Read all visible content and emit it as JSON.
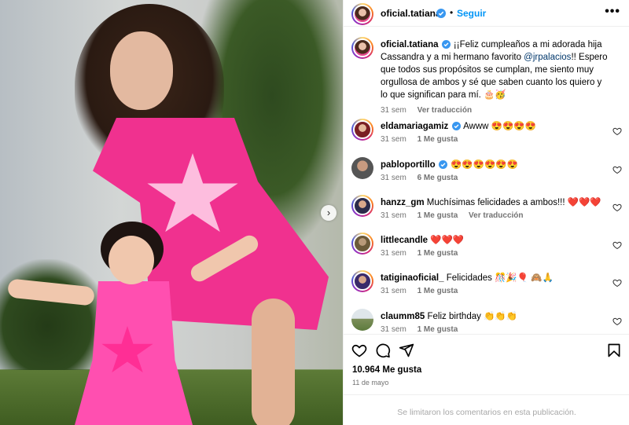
{
  "post": {
    "author": "oficial.tatiana",
    "follow_label": "Seguir",
    "more_label": "•••",
    "caption": "¡¡Feliz cumpleaños a mi adorada hija Cassandra y a mi hermano favorito ",
    "mention": "@jrpalacios",
    "caption_end": "!! Espero que todos sus propósitos se cumplan, me siento muy orgullosa de ambos y sé que saben cuanto los quiero y lo que significan para mí. 🎂🥳",
    "caption_time": "31 sem",
    "translate_label": "Ver traducción",
    "likes": "10.964 Me gusta",
    "date": "11 de mayo",
    "comments_limited": "Se limitaron los comentarios en esta publicación."
  },
  "carousel": {
    "next_icon": "›"
  },
  "comments": [
    {
      "user": "eldamariagamiz",
      "verified": true,
      "text": "Awww 😍😍😍😍",
      "time": "31 sem",
      "likes": "1 Me gusta",
      "translate": ""
    },
    {
      "user": "pabloportillo",
      "verified": true,
      "text": "😍😍😍😍😍😍",
      "time": "31 sem",
      "likes": "6 Me gusta",
      "translate": ""
    },
    {
      "user": "hanzz_gm",
      "verified": false,
      "text": "Muchísimas felicidades a ambos!!! ❤️❤️❤️",
      "time": "31 sem",
      "likes": "1 Me gusta",
      "translate": "Ver traducción"
    },
    {
      "user": "littlecandle",
      "verified": false,
      "text": "❤️❤️❤️",
      "time": "31 sem",
      "likes": "1 Me gusta",
      "translate": ""
    },
    {
      "user": "tatiginaoficial_",
      "verified": false,
      "text": "Felicidades 🎊🎉🎈 🙈🙏",
      "time": "31 sem",
      "likes": "1 Me gusta",
      "translate": ""
    },
    {
      "user": "claumm85",
      "verified": false,
      "text": "Feliz birthday 👏👏👏",
      "time": "31 sem",
      "likes": "1 Me gusta",
      "translate": ""
    }
  ],
  "icons": {
    "verified": "verified-badge-icon",
    "like": "heart-icon",
    "comment": "comment-icon",
    "share": "paper-plane-icon",
    "save": "bookmark-icon"
  },
  "colors": {
    "accent": "#0095f6",
    "verified": "#3897f0",
    "muted": "#737373",
    "mention": "#00376b"
  }
}
